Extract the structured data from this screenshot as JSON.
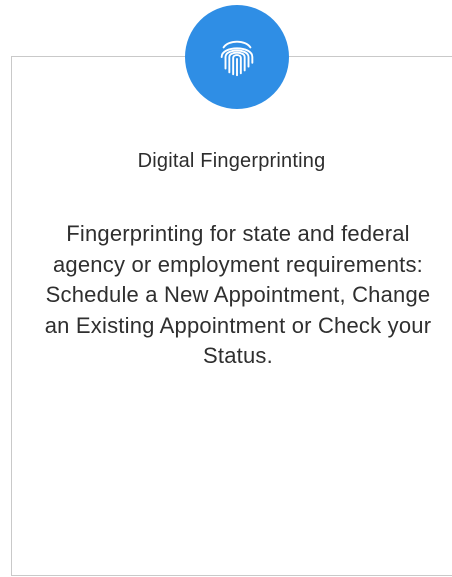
{
  "card": {
    "icon": "fingerprint-icon",
    "accent_color": "#2f8ee5",
    "title": "Digital Fingerprinting",
    "description": "Fingerprinting for state and federal agency or employment requirements: Schedule a New Appointment, Change an Existing Appointment or Check your Status."
  }
}
